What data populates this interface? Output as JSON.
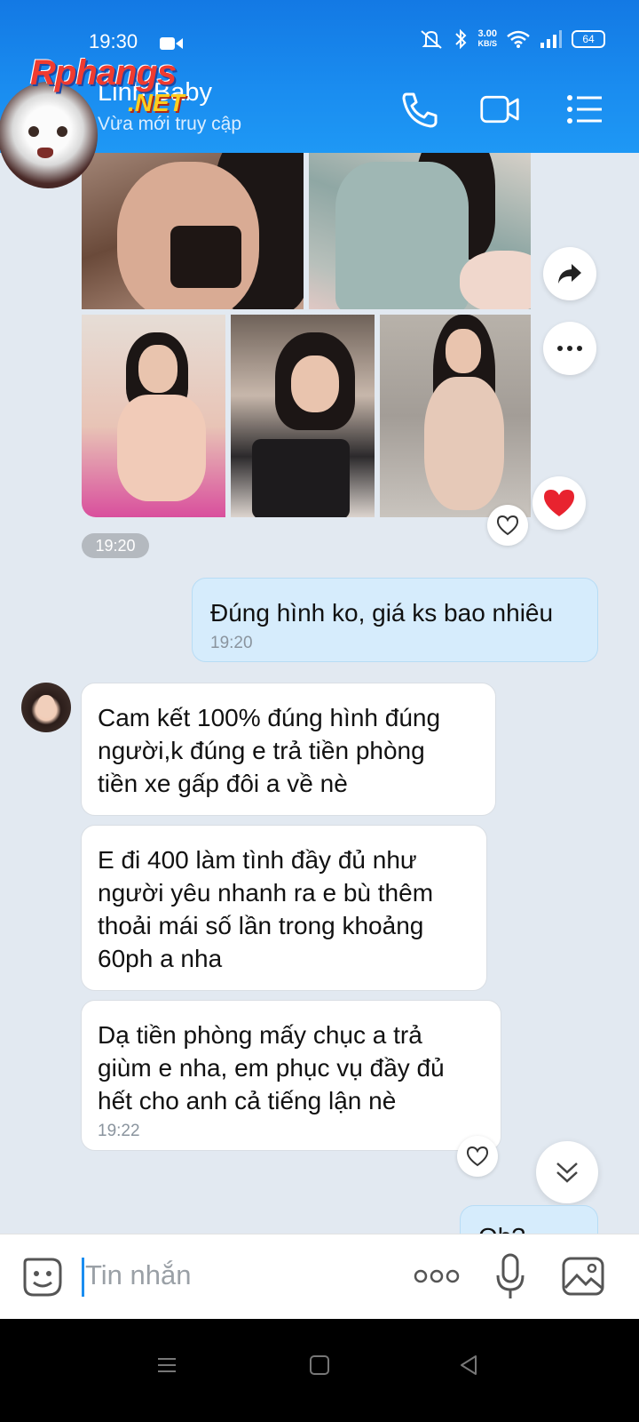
{
  "status_bar": {
    "time": "19:30",
    "speed_value": "3.00",
    "speed_unit": "KB/S",
    "battery": "64"
  },
  "header": {
    "contact_name": "Linh Baby",
    "contact_status": "Vừa mới truy cập",
    "watermark_brand": "Rphangs",
    "watermark_suffix": ".NET"
  },
  "chat": {
    "image_time": "19:20",
    "messages": [
      {
        "direction": "out",
        "text": "Đúng hình ko, giá ks bao nhiêu",
        "time": "19:20"
      },
      {
        "direction": "in",
        "text": "Cam kết 100% đúng hình đúng\nngười,k đúng e trả tiền phòng\ntiền xe gấp đôi a về nè"
      },
      {
        "direction": "in",
        "text": "E đi 400 làm tình đầy đủ như\nngười yêu nhanh ra e bù thêm\nthoải mái số lần trong khoảng\n60ph a nha"
      },
      {
        "direction": "in",
        "text": "Dạ tiền phòng mấy chục a trả\ngiùm e nha, em phục vụ đầy đủ\nhết cho anh cả tiếng lận nè",
        "time": "19:22"
      },
      {
        "direction": "out",
        "text": "Oh?"
      }
    ]
  },
  "input": {
    "placeholder": "Tin nhắn"
  },
  "colors": {
    "header": "#1a8df0",
    "incoming_bubble": "#ffffff",
    "outgoing_bubble": "#d6ecfc",
    "background": "#e2e9f1",
    "heart": "#e8232f"
  }
}
